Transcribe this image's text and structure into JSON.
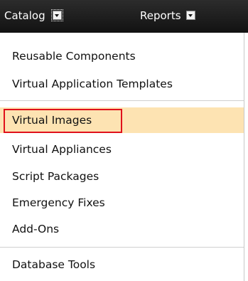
{
  "menubar": {
    "catalog_label": "Catalog",
    "reports_label": "Reports"
  },
  "menu": {
    "groups": [
      {
        "items": [
          {
            "label": "Reusable Components"
          },
          {
            "label": "Virtual Application Templates"
          }
        ]
      },
      {
        "items": [
          {
            "label": "Virtual Images",
            "selected": true
          },
          {
            "label": "Virtual Appliances"
          },
          {
            "label": "Script Packages"
          },
          {
            "label": "Emergency Fixes"
          },
          {
            "label": "Add-Ons"
          }
        ]
      },
      {
        "items": [
          {
            "label": "Database Tools"
          }
        ]
      }
    ]
  },
  "colors": {
    "menubar_bg": "#1a1a1a",
    "selected_bg": "#fde3b2",
    "highlight_border": "#e0111b"
  },
  "icons": {
    "dropdown": "chevron-down-icon"
  }
}
